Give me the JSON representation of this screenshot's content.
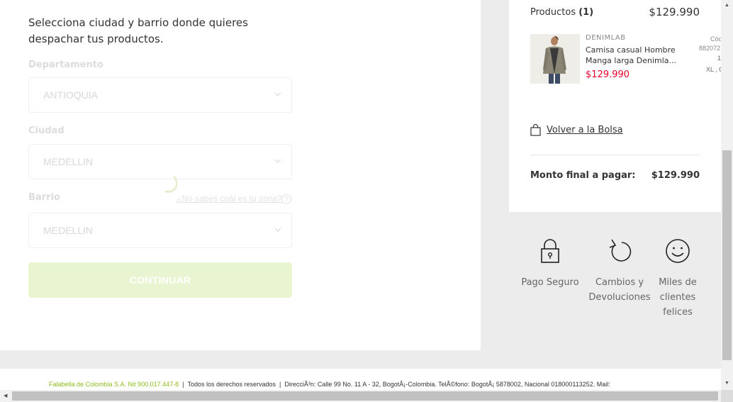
{
  "form": {
    "intro": "Selecciona ciudad y barrio donde quieres despachar tus productos.",
    "department_label": "Departamento",
    "department_value": "ANTIOQUIA",
    "city_label": "Ciudad",
    "city_value": "MEDELLIN",
    "neighborhood_label": "Barrio",
    "neighborhood_value": "MEDELLIN",
    "zone_help_link": "¿No sabes cuál es tu zona?",
    "help_icon": "?",
    "continue_button": "CONTINUAR"
  },
  "summary": {
    "products_label": "Productos",
    "products_count": "(1)",
    "products_total": "$129.990",
    "item": {
      "brand": "DENIMLAB",
      "name": "Camisa casual Hombre Manga larga Denimla...",
      "price": "$129.990",
      "code_label": "Cód",
      "code_value": "882072",
      "quantity": "1",
      "size": "XL , C"
    },
    "back_link": "Volver a la Bolsa",
    "final_label": "Monto final a pagar:",
    "final_value": "$129.990"
  },
  "trust": [
    {
      "icon": "padlock-icon",
      "label": "Pago Seguro"
    },
    {
      "icon": "return-arrow-icon",
      "label": "Cambios y Devoluciones"
    },
    {
      "icon": "smiley-face-icon",
      "label": "Miles de clientes felices"
    }
  ],
  "footer": {
    "company": "Falabella de Colombia S.A. Nit 900.017.447-8",
    "rights": "Todos los derechos reservados",
    "address": "DirecciÃ³n: Calle 99 No. 11 A - 32, BogotÃ¡-Colombia. TelÃ©fono: BogotÃ¡ 5878002, Nacional 018000113252. Mail:"
  },
  "colors": {
    "accent_green": "#8dbc1d",
    "button_disabled": "#e9f5d0",
    "price_red": "#e4002b"
  }
}
